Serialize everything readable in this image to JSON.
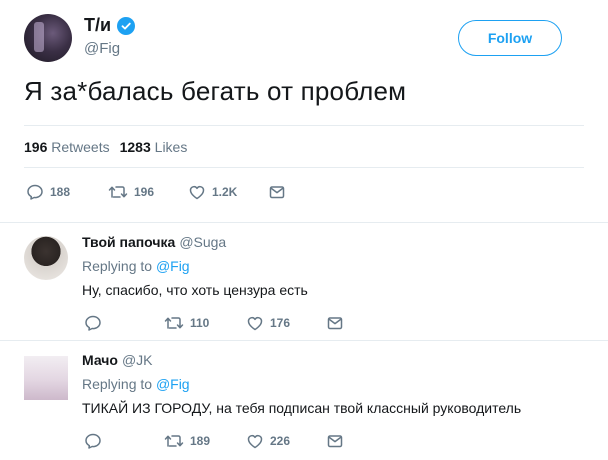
{
  "tweet": {
    "author_name": "Т/и",
    "author_handle": "@Fig",
    "follow_label": "Follow",
    "text": "Я за*балась бегать от проблем",
    "retweets_count": "196",
    "retweets_label": "Retweets",
    "likes_count": "1283",
    "likes_label": "Likes",
    "actions": {
      "replies": "188",
      "retweets": "196",
      "likes": "1.2K"
    }
  },
  "replies": [
    {
      "name": "Твой папочка",
      "handle": "@Suga",
      "replying_prefix": "Replying to",
      "replying_to": "@Fig",
      "text": "Ну, спасибо, что хоть цензура есть",
      "actions": {
        "replies": "",
        "retweets": "110",
        "likes": "176"
      }
    },
    {
      "name": "Мачо",
      "handle": "@JK",
      "replying_prefix": "Replying to",
      "replying_to": "@Fig",
      "text": "ТИКАЙ ИЗ ГОРОДУ, на тебя подписан твой классный руководитель",
      "actions": {
        "replies": "",
        "retweets": "189",
        "likes": "226"
      }
    }
  ],
  "colors": {
    "accent": "#1da1f2",
    "muted": "#657786",
    "text": "#14171a",
    "divider": "#e6ecf0"
  },
  "icons": [
    "verified-badge-icon",
    "reply-icon",
    "retweet-icon",
    "like-icon",
    "direct-message-icon"
  ]
}
